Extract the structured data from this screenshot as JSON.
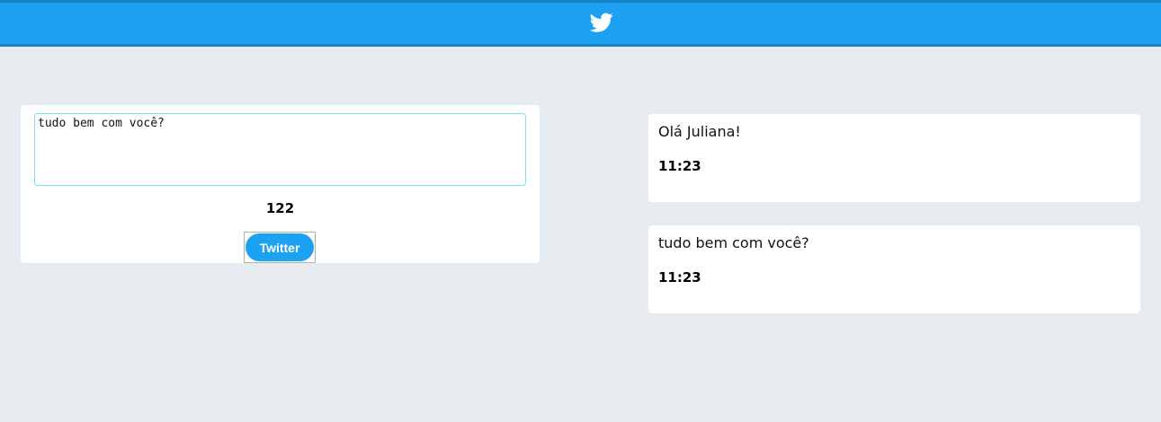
{
  "header": {
    "logo_icon": "twitter-bird-icon",
    "background_color": "#1da1f2"
  },
  "compose": {
    "textarea_value": "tudo bem com você?",
    "counter": "122",
    "button_label": "Twitter",
    "button_color": "#1da1f2"
  },
  "tweets": [
    {
      "text": "Olá Juliana!",
      "time": "11:23"
    },
    {
      "text": "tudo bem com você?",
      "time": "11:23"
    }
  ]
}
